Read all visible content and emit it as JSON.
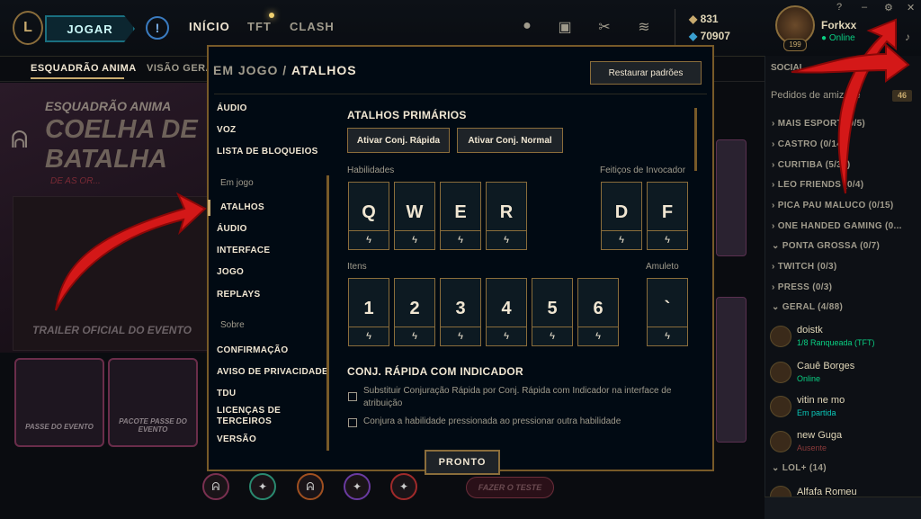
{
  "topbar": {
    "logo": "L",
    "play": "JOGAR",
    "alert_icon": "!",
    "nav": [
      "INÍCIO",
      "TFT",
      "CLASH"
    ],
    "icons": [
      "profile-icon",
      "collection-icon",
      "loot-icon",
      "store-icon"
    ],
    "currency": {
      "rp": "831",
      "be": "70907"
    },
    "user": {
      "name": "Forkxx",
      "status": "Online",
      "level": "199"
    },
    "window_controls": [
      "?",
      "–",
      "⚙",
      "✕"
    ]
  },
  "page": {
    "subnav": [
      "ESQUADRÃO ANIMA",
      "VISÃO GERA"
    ],
    "hero": {
      "subtitle": "ESQUADRÃO ANIMA",
      "title": "COELHA DE BATALHA",
      "small": "DE AS OR..."
    },
    "trailer": "TRAILER OFICIAL DO EVENTO",
    "cards": [
      "PASSE DO EVENTO",
      "PACOTE PASSE DO EVENTO"
    ],
    "test_button": "FAZER O TESTE"
  },
  "social": {
    "title": "SOCIAL",
    "friend_requests": "Pedidos de amizade",
    "friend_requests_count": "46",
    "groups": [
      "MAIS ESPORT (0/5)",
      "CASTRO (0/14)",
      "CURITIBA (5/37)",
      "LEO FRIENDS (0/4)",
      "PICA PAU MALUCO (0/15)",
      "ONE HANDED GAMING (0...",
      "PONTA GROSSA (0/7)",
      "TWITCH (0/3)",
      "PRESS (0/3)",
      "GERAL (4/88)"
    ],
    "friends": [
      {
        "name": "doistk",
        "status": "1/8 Ranqueada (TFT)",
        "color": "#0acf83"
      },
      {
        "name": "Cauê Borges",
        "status": "Online",
        "color": "#0acf83"
      },
      {
        "name": "vitin ne mo",
        "status": "Em partida",
        "color": "#0ac8b9"
      },
      {
        "name": "new Guga",
        "status": "Ausente",
        "color": "#8a3a3a"
      }
    ],
    "group_lol": "LOL+ (14)",
    "last_friend": "Alfafa Romeu"
  },
  "modal": {
    "breadcrumb_section": "EM JOGO",
    "breadcrumb_sep": "/",
    "breadcrumb_page": "ATALHOS",
    "restore": "Restaurar padrões",
    "menu_top": [
      "ÁUDIO",
      "VOZ",
      "LISTA DE BLOQUEIOS"
    ],
    "menu_ingame_header": "Em jogo",
    "menu_ingame": [
      "ATALHOS",
      "ÁUDIO",
      "INTERFACE",
      "JOGO",
      "REPLAYS"
    ],
    "menu_about_header": "Sobre",
    "menu_about": [
      "CONFIRMAÇÃO",
      "AVISO DE PRIVACIDADE",
      "TDU",
      "LICENÇAS DE TERCEIROS",
      "VERSÃO"
    ],
    "primary_title": "ATALHOS PRIMÁRIOS",
    "quickcast_btn": "Ativar Conj. Rápida",
    "normalcast_btn": "Ativar Conj. Normal",
    "abilities_label": "Habilidades",
    "summoner_label": "Feitiços de Invocador",
    "abilities": [
      "Q",
      "W",
      "E",
      "R"
    ],
    "summoners": [
      "D",
      "F"
    ],
    "items_label": "Itens",
    "trinket_label": "Amuleto",
    "items": [
      "1",
      "2",
      "3",
      "4",
      "5",
      "6"
    ],
    "trinket": "`",
    "bolt": "ϟ",
    "indicator_title": "CONJ. RÁPIDA COM INDICADOR",
    "option1": "Substituir Conjuração Rápida por Conj. Rápida com Indicador na interface de atribuição",
    "option2": "Conjura a habilidade pressionada ao pressionar outra habilidade",
    "done": "PRONTO"
  }
}
